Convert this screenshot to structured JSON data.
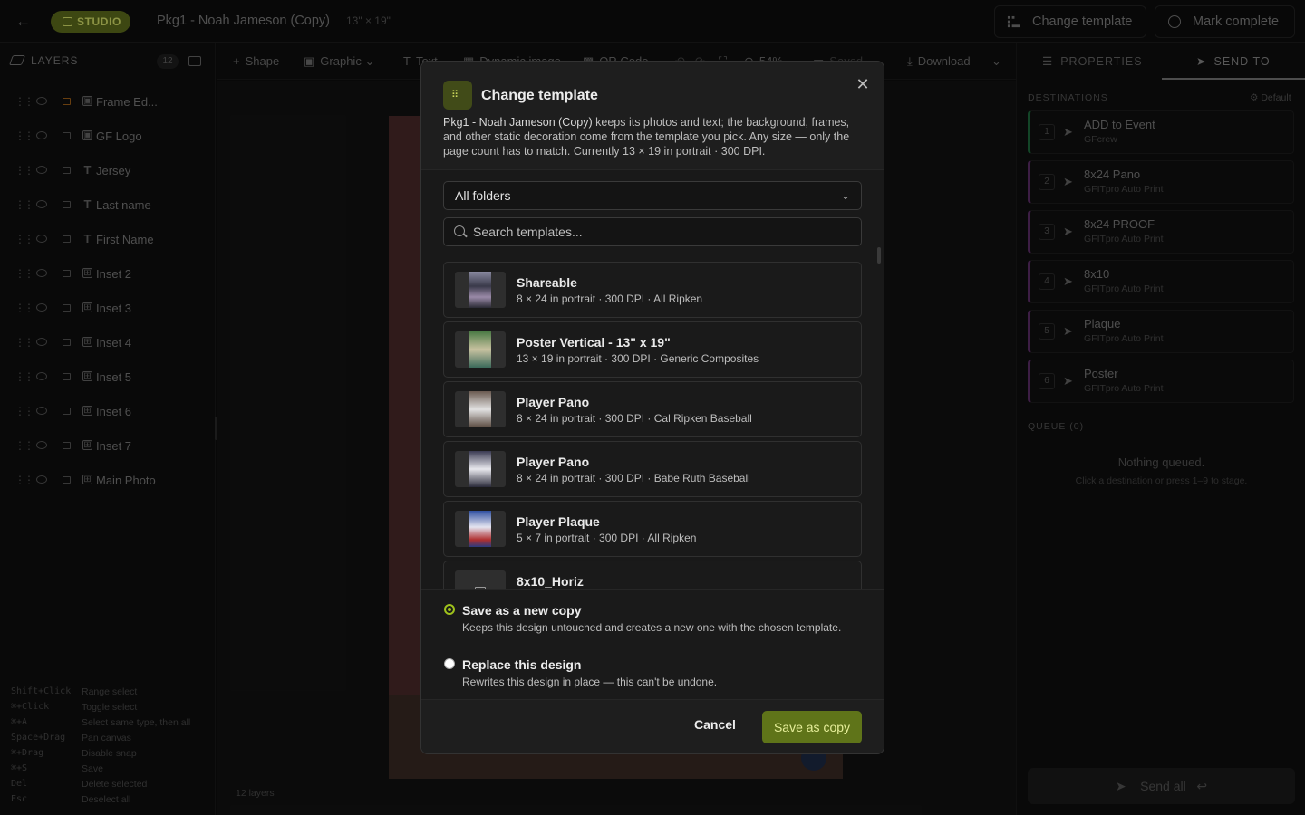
{
  "header": {
    "back_icon": "arrow-left-icon",
    "badge": "STUDIO",
    "title": "Pkg1 - Noah Jameson (Copy)",
    "size": "13\" × 19\"",
    "change_template": "Change template",
    "mark_complete": "Mark complete"
  },
  "layers": {
    "heading": "LAYERS",
    "count": "12",
    "items": [
      {
        "name": "Frame Ed...",
        "type": "image",
        "locked": true
      },
      {
        "name": "GF Logo",
        "type": "image"
      },
      {
        "name": "Jersey",
        "type": "text"
      },
      {
        "name": "Last name",
        "type": "text"
      },
      {
        "name": "First Name",
        "type": "text"
      },
      {
        "name": "Inset 2",
        "type": "dynamic"
      },
      {
        "name": "Inset 3",
        "type": "dynamic"
      },
      {
        "name": "Inset 4",
        "type": "dynamic"
      },
      {
        "name": "Inset 5",
        "type": "dynamic"
      },
      {
        "name": "Inset 6",
        "type": "dynamic"
      },
      {
        "name": "Inset 7",
        "type": "dynamic"
      },
      {
        "name": "Main Photo",
        "type": "dynamic"
      }
    ],
    "shortcuts": [
      {
        "key": "Shift+Click",
        "desc": "Range select"
      },
      {
        "key": "⌘+Click",
        "desc": "Toggle select"
      },
      {
        "key": "⌘+A",
        "desc": "Select same type, then all"
      },
      {
        "key": "Space+Drag",
        "desc": "Pan canvas"
      },
      {
        "key": "⌘+Drag",
        "desc": "Disable snap"
      },
      {
        "key": "⌘+S",
        "desc": "Save"
      },
      {
        "key": "Del",
        "desc": "Delete selected"
      },
      {
        "key": "Esc",
        "desc": "Deselect all"
      }
    ]
  },
  "toolbar": {
    "shape": "Shape",
    "graphic": "Graphic",
    "text": "Text",
    "dynamic_image": "Dynamic image",
    "qr_code": "QR Code",
    "zoom": "54%",
    "saved": "Saved",
    "download": "Download"
  },
  "canvas": {
    "footer": "12 layers"
  },
  "right_panel": {
    "tab_properties": "PROPERTIES",
    "tab_send_to": "SEND TO",
    "destinations_heading": "DESTINATIONS",
    "default_label": "Default",
    "destinations": [
      {
        "num": "1",
        "name": "ADD to Event",
        "sub": "GFcrew",
        "color": "#1e6a3c"
      },
      {
        "num": "2",
        "name": "8x24 Pano",
        "sub": "GFITpro Auto Print",
        "color": "#5e2e6a"
      },
      {
        "num": "3",
        "name": "8x24 PROOF",
        "sub": "GFITpro Auto Print",
        "color": "#5e2e6a"
      },
      {
        "num": "4",
        "name": "8x10",
        "sub": "GFITpro Auto Print",
        "color": "#5e2e6a"
      },
      {
        "num": "5",
        "name": "Plaque",
        "sub": "GFITpro Auto Print",
        "color": "#5e2e6a"
      },
      {
        "num": "6",
        "name": "Poster",
        "sub": "GFITpro Auto Print",
        "color": "#5e2e6a"
      }
    ],
    "queue_heading": "QUEUE (0)",
    "empty_title": "Nothing queued.",
    "empty_hint": "Click a destination or press 1–9 to stage.",
    "send_all": "Send all"
  },
  "modal": {
    "title": "Change template",
    "desc_bold": "Pkg1 - Noah Jameson (Copy)",
    "desc_rest": " keeps its photos and text; the background, frames, and other static decoration come from the template you pick. Any size — only the page count has to match. Currently 13 × 19 in portrait · 300 DPI.",
    "folder_select": "All folders",
    "search_placeholder": "Search templates...",
    "templates": [
      {
        "name": "Shareable",
        "meta": "8 × 24 in portrait · 300 DPI · All Ripken"
      },
      {
        "name": "Poster Vertical - 13\" x 19\"",
        "meta": "13 × 19 in portrait · 300 DPI · Generic Composites"
      },
      {
        "name": "Player Pano",
        "meta": "8 × 24 in portrait · 300 DPI · Cal Ripken Baseball"
      },
      {
        "name": "Player Pano",
        "meta": "8 × 24 in portrait · 300 DPI · Babe Ruth Baseball"
      },
      {
        "name": "Player Plaque",
        "meta": "5 × 7 in portrait · 300 DPI · All Ripken"
      },
      {
        "name": "8x10_Horiz",
        "meta": ""
      }
    ],
    "option_copy_title": "Save as a new copy",
    "option_copy_desc": "Keeps this design untouched and creates a new one with the chosen template.",
    "option_replace_title": "Replace this design",
    "option_replace_desc": "Rewrites this design in place — this can't be undone.",
    "selected_option": "copy",
    "cancel": "Cancel",
    "save": "Save as copy",
    "accent": "#9fc21c"
  }
}
